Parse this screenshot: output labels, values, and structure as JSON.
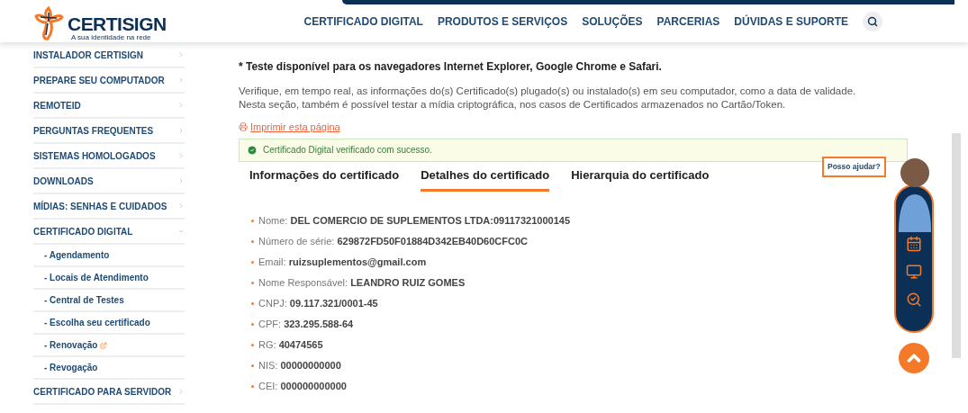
{
  "header": {
    "logo": {
      "name": "CERTISIGN",
      "tagline": "A sua identidade na rede"
    },
    "nav": [
      "CERTIFICADO DIGITAL",
      "PRODUTOS E SERVIÇOS",
      "SOLUÇÕES",
      "PARCERIAS",
      "DÚVIDAS E SUPORTE"
    ]
  },
  "sidebar": {
    "items": [
      {
        "kind": "main",
        "label": "INSTALADOR CERTISIGN",
        "expanded": false
      },
      {
        "kind": "main",
        "label": "PREPARE SEU COMPUTADOR",
        "expanded": false
      },
      {
        "kind": "main",
        "label": "REMOTEID",
        "expanded": false
      },
      {
        "kind": "main",
        "label": "PERGUNTAS FREQUENTES",
        "expanded": false
      },
      {
        "kind": "main",
        "label": "SISTEMAS HOMOLOGADOS",
        "expanded": false
      },
      {
        "kind": "main",
        "label": "DOWNLOADS",
        "expanded": false
      },
      {
        "kind": "main",
        "label": "MÍDIAS: SENHAS E CUIDADOS",
        "expanded": false
      },
      {
        "kind": "main",
        "label": "CERTIFICADO DIGITAL",
        "expanded": true
      },
      {
        "kind": "sub",
        "label": "- Agendamento",
        "external": false
      },
      {
        "kind": "sub",
        "label": "- Locais de Atendimento",
        "external": false
      },
      {
        "kind": "sub",
        "label": "- Central de Testes",
        "external": false
      },
      {
        "kind": "sub",
        "label": "- Escolha seu certificado",
        "external": false
      },
      {
        "kind": "sub",
        "label": "- Renovação",
        "external": true
      },
      {
        "kind": "sub",
        "label": "- Revogação",
        "external": false
      },
      {
        "kind": "main",
        "label": "CERTIFICADO PARA SERVIDOR",
        "expanded": false
      }
    ]
  },
  "content": {
    "notice": "* Teste disponível para os navegadores Internet Explorer, Google Chrome e Safari.",
    "description": [
      "Verifique, em tempo real, as informações do(s) Certificado(s) plugado(s) ou instalado(s) em seu computador, como a data de validade.",
      "Nesta seção, também é possível testar a mídia criptográfica, nos casos de Certificados armazenados no Cartão/Token."
    ],
    "print_link": "Imprimir esta página",
    "success_alert": "Certificado Digital verificado com sucesso.",
    "tabs": [
      {
        "label": "Informações do certificado",
        "selected": false
      },
      {
        "label": "Detalhes do certificado",
        "selected": true
      },
      {
        "label": "Hierarquia do certificado",
        "selected": false
      }
    ],
    "details": [
      {
        "label": "Nome:",
        "value": "DEL COMERCIO DE SUPLEMENTOS LTDA:09117321000145"
      },
      {
        "label": "Número de série:",
        "value": "629872FD50F01884D342EB40D60CFC0C"
      },
      {
        "label": "Email:",
        "value": "ruizsuplementos@gmail.com"
      },
      {
        "label": "Nome Responsável:",
        "value": "LEANDRO RUIZ GOMES"
      },
      {
        "label": "CNPJ:",
        "value": "09.117.321/0001-45"
      },
      {
        "label": "CPF:",
        "value": "323.295.588-64"
      },
      {
        "label": "RG:",
        "value": "40474565"
      },
      {
        "label": "NIS:",
        "value": "00000000000"
      },
      {
        "label": "CEI:",
        "value": "000000000000"
      }
    ]
  },
  "assistant": {
    "bubble": "Posso ajudar?"
  }
}
